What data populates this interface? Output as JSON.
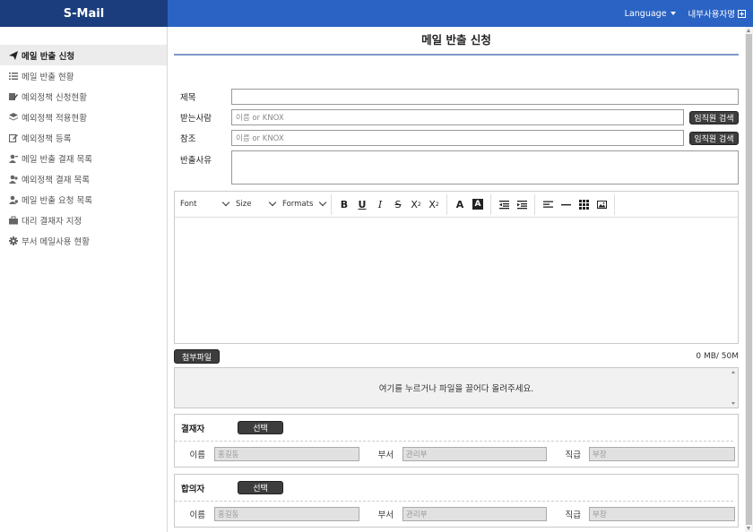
{
  "header": {
    "brand": "S-Mail",
    "language_label": "Language",
    "user_label": "내부사용자명"
  },
  "sidebar": {
    "items": [
      {
        "label": "메일 반출 신청",
        "icon": "paper-plane-icon",
        "active": true
      },
      {
        "label": "메일 반출 현황",
        "icon": "list-icon",
        "active": false
      },
      {
        "label": "예외정책 신청현황",
        "icon": "edit-doc-icon",
        "active": false
      },
      {
        "label": "예외정책 적용현황",
        "icon": "layers-icon",
        "active": false
      },
      {
        "label": "예외정책 등록",
        "icon": "edit-icon",
        "active": false
      },
      {
        "label": "메일 반출 결재 목록",
        "icon": "user-check-icon",
        "active": false
      },
      {
        "label": "예외정책 결재 목록",
        "icon": "users-icon",
        "active": false
      },
      {
        "label": "메일 반출 요청 목록",
        "icon": "user-gear-icon",
        "active": false
      },
      {
        "label": "대리 결재자 지정",
        "icon": "briefcase-icon",
        "active": false
      },
      {
        "label": "부서 메일사용 현황",
        "icon": "gear-icon",
        "active": false
      }
    ]
  },
  "form": {
    "title": "메일 반출 신청",
    "subject_label": "제목",
    "subject_value": "",
    "to_label": "받는사람",
    "to_placeholder": "이름 or KNOX",
    "cc_label": "참조",
    "cc_placeholder": "이름 or KNOX",
    "search_button": "임직원 검색",
    "reason_label": "반출사유",
    "reason_value": ""
  },
  "editor": {
    "font_select": "Font",
    "size_select": "Size",
    "formats_select": "Formats",
    "tools": [
      "bold-icon",
      "underline-icon",
      "italic-icon",
      "strikethrough-icon",
      "subscript-icon",
      "superscript-icon",
      "font-color-icon",
      "background-color-icon",
      "outdent-icon",
      "indent-icon",
      "align-left-icon",
      "horizontal-rule-icon",
      "table-icon",
      "image-icon"
    ]
  },
  "attachment": {
    "button": "첨부파일",
    "usage": "0 MB/ 50M",
    "dropzone_text": "여기를 누르거나 파일을 끌어다 올려주세요."
  },
  "approver": {
    "label": "결재자",
    "select_button": "선택",
    "name_label": "이름",
    "name_placeholder": "홍길동",
    "dept_label": "부서",
    "dept_placeholder": "관리부",
    "rank_label": "직급",
    "rank_placeholder": "부장"
  },
  "consenter": {
    "label": "합의자",
    "select_button": "선택",
    "name_label": "이름",
    "name_placeholder": "홍길동",
    "dept_label": "부서",
    "dept_placeholder": "관리부",
    "rank_label": "직급",
    "rank_placeholder": "부장"
  },
  "colors": {
    "brand_bg": "#1b3d7d",
    "nav_bg": "#2a63c3",
    "button_dark": "#3d3d3d"
  }
}
